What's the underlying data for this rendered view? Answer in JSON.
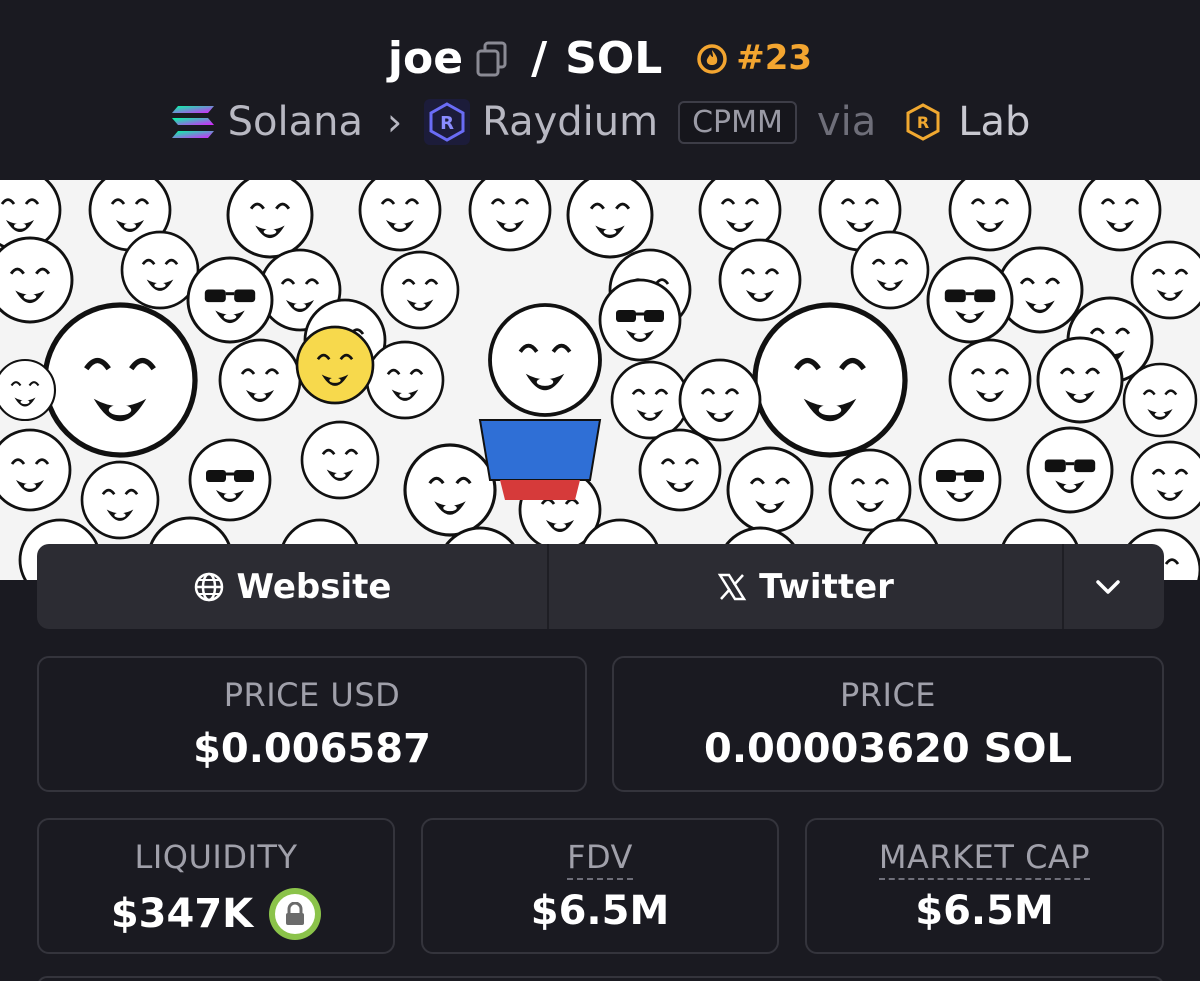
{
  "pair": {
    "base": "joe",
    "separator": "/",
    "quote": "SOL",
    "rank": "#23"
  },
  "breadcrumb": {
    "chain": "Solana",
    "dex": "Raydium",
    "pool_type": "CPMM",
    "via_label": "via",
    "launchpad": "Lab"
  },
  "links": {
    "website_label": "Website",
    "twitter_label": "Twitter"
  },
  "stats": {
    "price_usd_label": "PRICE USD",
    "price_usd_value": "$0.006587",
    "price_label": "PRICE",
    "price_value": "0.00003620 SOL",
    "liquidity_label": "LIQUIDITY",
    "liquidity_value": "$347K",
    "fdv_label": "FDV",
    "fdv_value": "$6.5M",
    "market_cap_label": "MARKET CAP",
    "market_cap_value": "$6.5M"
  },
  "colors": {
    "background": "#1a1a21",
    "rank_accent": "#f3a530",
    "lock_green": "#8bc34a",
    "card_border": "#34343c"
  }
}
